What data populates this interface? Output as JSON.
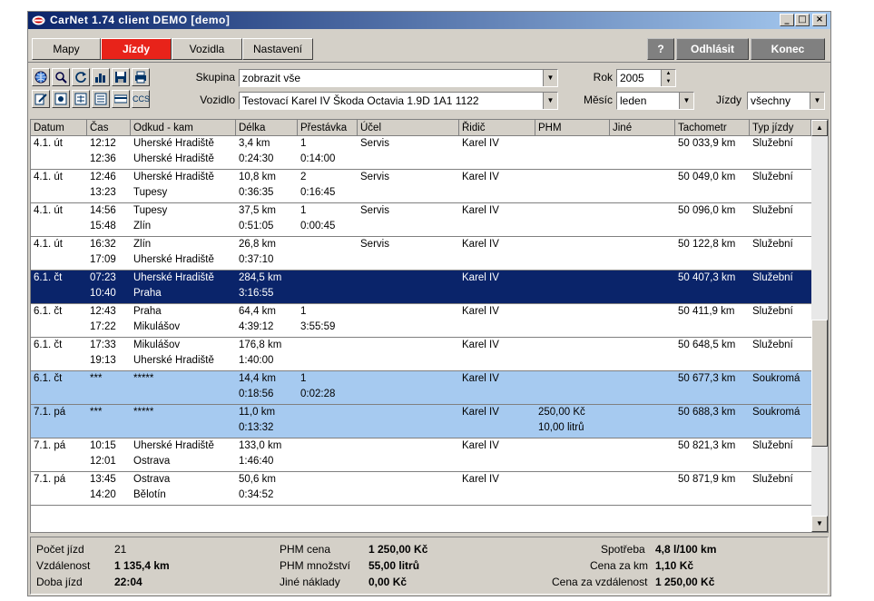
{
  "window": {
    "title": "CarNet  1.74  client  DEMO  [demo]"
  },
  "tabs": [
    {
      "label": "Mapy"
    },
    {
      "label": "Jízdy"
    },
    {
      "label": "Vozidla"
    },
    {
      "label": "Nastavení"
    }
  ],
  "right_buttons": {
    "help": "?",
    "logout": "Odhlásit",
    "end": "Konec"
  },
  "filters": {
    "group_label": "Skupina",
    "group_value": "zobrazit vše",
    "vehicle_label": "Vozidlo",
    "vehicle_value": "Testovací  Karel  IV  Škoda Octavia 1.9D  1A1 1122",
    "year_label": "Rok",
    "year_value": "2005",
    "month_label": "Měsíc",
    "month_value": "leden",
    "trips_label": "Jízdy",
    "trips_value": "všechny"
  },
  "toolbar_extra_label": "CCS",
  "columns": [
    "Datum",
    "Čas",
    "Odkud - kam",
    "Délka",
    "Přestávka",
    "Účel",
    "Řidič",
    "PHM",
    "Jiné",
    "Tachometr",
    "Typ jízdy"
  ],
  "rows": [
    {
      "date": "4.1.  út",
      "time1": "12:12",
      "time2": "12:36",
      "from": "Uherské Hradiště",
      "to": "Uherské Hradiště",
      "dist": "3,4 km",
      "dur": "0:24:30",
      "stops": "1",
      "stoptime": "0:14:00",
      "purpose": "Servis",
      "driver": "Karel  IV",
      "fuel1": "",
      "fuel2": "",
      "other": "",
      "odo": "50 033,9 km",
      "type": "Služební",
      "style": ""
    },
    {
      "date": "4.1.  út",
      "time1": "12:46",
      "time2": "13:23",
      "from": "Uherské Hradiště",
      "to": "Tupesy",
      "dist": "10,8 km",
      "dur": "0:36:35",
      "stops": "2",
      "stoptime": "0:16:45",
      "purpose": "Servis",
      "driver": "Karel  IV",
      "fuel1": "",
      "fuel2": "",
      "other": "",
      "odo": "50 049,0 km",
      "type": "Služební",
      "style": ""
    },
    {
      "date": "4.1.  út",
      "time1": "14:56",
      "time2": "15:48",
      "from": "Tupesy",
      "to": "Zlín",
      "dist": "37,5 km",
      "dur": "0:51:05",
      "stops": "1",
      "stoptime": "0:00:45",
      "purpose": "Servis",
      "driver": "Karel  IV",
      "fuel1": "",
      "fuel2": "",
      "other": "",
      "odo": "50 096,0 km",
      "type": "Služební",
      "style": ""
    },
    {
      "date": "4.1.  út",
      "time1": "16:32",
      "time2": "17:09",
      "from": "Zlín",
      "to": "Uherské Hradiště",
      "dist": "26,8 km",
      "dur": "0:37:10",
      "stops": "",
      "stoptime": "",
      "purpose": "Servis",
      "driver": "Karel  IV",
      "fuel1": "",
      "fuel2": "",
      "other": "",
      "odo": "50 122,8 km",
      "type": "Služební",
      "style": ""
    },
    {
      "date": "6.1.  čt",
      "time1": "07:23",
      "time2": "10:40",
      "from": "Uherské Hradiště",
      "to": "Praha",
      "dist": "284,5 km",
      "dur": "3:16:55",
      "stops": "",
      "stoptime": "",
      "purpose": "",
      "driver": "Karel  IV",
      "fuel1": "",
      "fuel2": "",
      "other": "",
      "odo": "50 407,3 km",
      "type": "Služební",
      "style": "sel"
    },
    {
      "date": "6.1.  čt",
      "time1": "12:43",
      "time2": "17:22",
      "from": "Praha",
      "to": "Mikulášov",
      "dist": "64,4 km",
      "dur": "4:39:12",
      "stops": "1",
      "stoptime": "3:55:59",
      "purpose": "",
      "driver": "Karel  IV",
      "fuel1": "",
      "fuel2": "",
      "other": "",
      "odo": "50 411,9 km",
      "type": "Služební",
      "style": ""
    },
    {
      "date": "6.1.  čt",
      "time1": "17:33",
      "time2": "19:13",
      "from": "Mikulášov",
      "to": "Uherské Hradiště",
      "dist": "176,8 km",
      "dur": "1:40:00",
      "stops": "",
      "stoptime": "",
      "purpose": "",
      "driver": "Karel  IV",
      "fuel1": "",
      "fuel2": "",
      "other": "",
      "odo": "50 648,5 km",
      "type": "Služební",
      "style": ""
    },
    {
      "date": "6.1.  čt",
      "time1": "***",
      "time2": "",
      "from": "*****",
      "to": "",
      "dist": "14,4 km",
      "dur": "0:18:56",
      "stops": "1",
      "stoptime": "0:02:28",
      "purpose": "",
      "driver": "Karel  IV",
      "fuel1": "",
      "fuel2": "",
      "other": "",
      "odo": "50 677,3 km",
      "type": "Soukromá",
      "style": "priv"
    },
    {
      "date": "7.1.  pá",
      "time1": "***",
      "time2": "",
      "from": "*****",
      "to": "",
      "dist": "11,0 km",
      "dur": "0:13:32",
      "stops": "",
      "stoptime": "",
      "purpose": "",
      "driver": "Karel  IV",
      "fuel1": "250,00 Kč",
      "fuel2": "10,00 litrů",
      "other": "",
      "odo": "50 688,3 km",
      "type": "Soukromá",
      "style": "priv"
    },
    {
      "date": "7.1.  pá",
      "time1": "10:15",
      "time2": "12:01",
      "from": "Uherské Hradiště",
      "to": "Ostrava",
      "dist": "133,0 km",
      "dur": "1:46:40",
      "stops": "",
      "stoptime": "",
      "purpose": "",
      "driver": "Karel  IV",
      "fuel1": "",
      "fuel2": "",
      "other": "",
      "odo": "50 821,3 km",
      "type": "Služební",
      "style": ""
    },
    {
      "date": "7.1.  pá",
      "time1": "13:45",
      "time2": "14:20",
      "from": "Ostrava",
      "to": "Bělotín",
      "dist": "50,6 km",
      "dur": "0:34:52",
      "stops": "",
      "stoptime": "",
      "purpose": "",
      "driver": "Karel  IV",
      "fuel1": "",
      "fuel2": "",
      "other": "",
      "odo": "50 871,9 km",
      "type": "Služební",
      "style": ""
    }
  ],
  "summary": {
    "trips_count_label": "Počet jízd",
    "trips_count": "21",
    "distance_label": "Vzdálenost",
    "distance": "1 135,4 km",
    "duration_label": "Doba jízd",
    "duration": "22:04",
    "fuel_price_label": "PHM cena",
    "fuel_price": "1 250,00 Kč",
    "fuel_qty_label": "PHM množství",
    "fuel_qty": "55,00 litrů",
    "other_costs_label": "Jiné náklady",
    "other_costs": "0,00 Kč",
    "consumption_label": "Spotřeba",
    "consumption": "4,8 l/100 km",
    "price_per_km_label": "Cena za km",
    "price_per_km": "1,10 Kč",
    "price_per_dist_label": "Cena za vzdálenost",
    "price_per_dist": "1 250,00 Kč"
  },
  "icons": [
    "globe-icon",
    "search-icon",
    "refresh-icon",
    "chart-icon",
    "save-icon",
    "print-icon",
    "edit-icon",
    "record-icon",
    "calc-icon",
    "list-icon",
    "card-icon"
  ]
}
